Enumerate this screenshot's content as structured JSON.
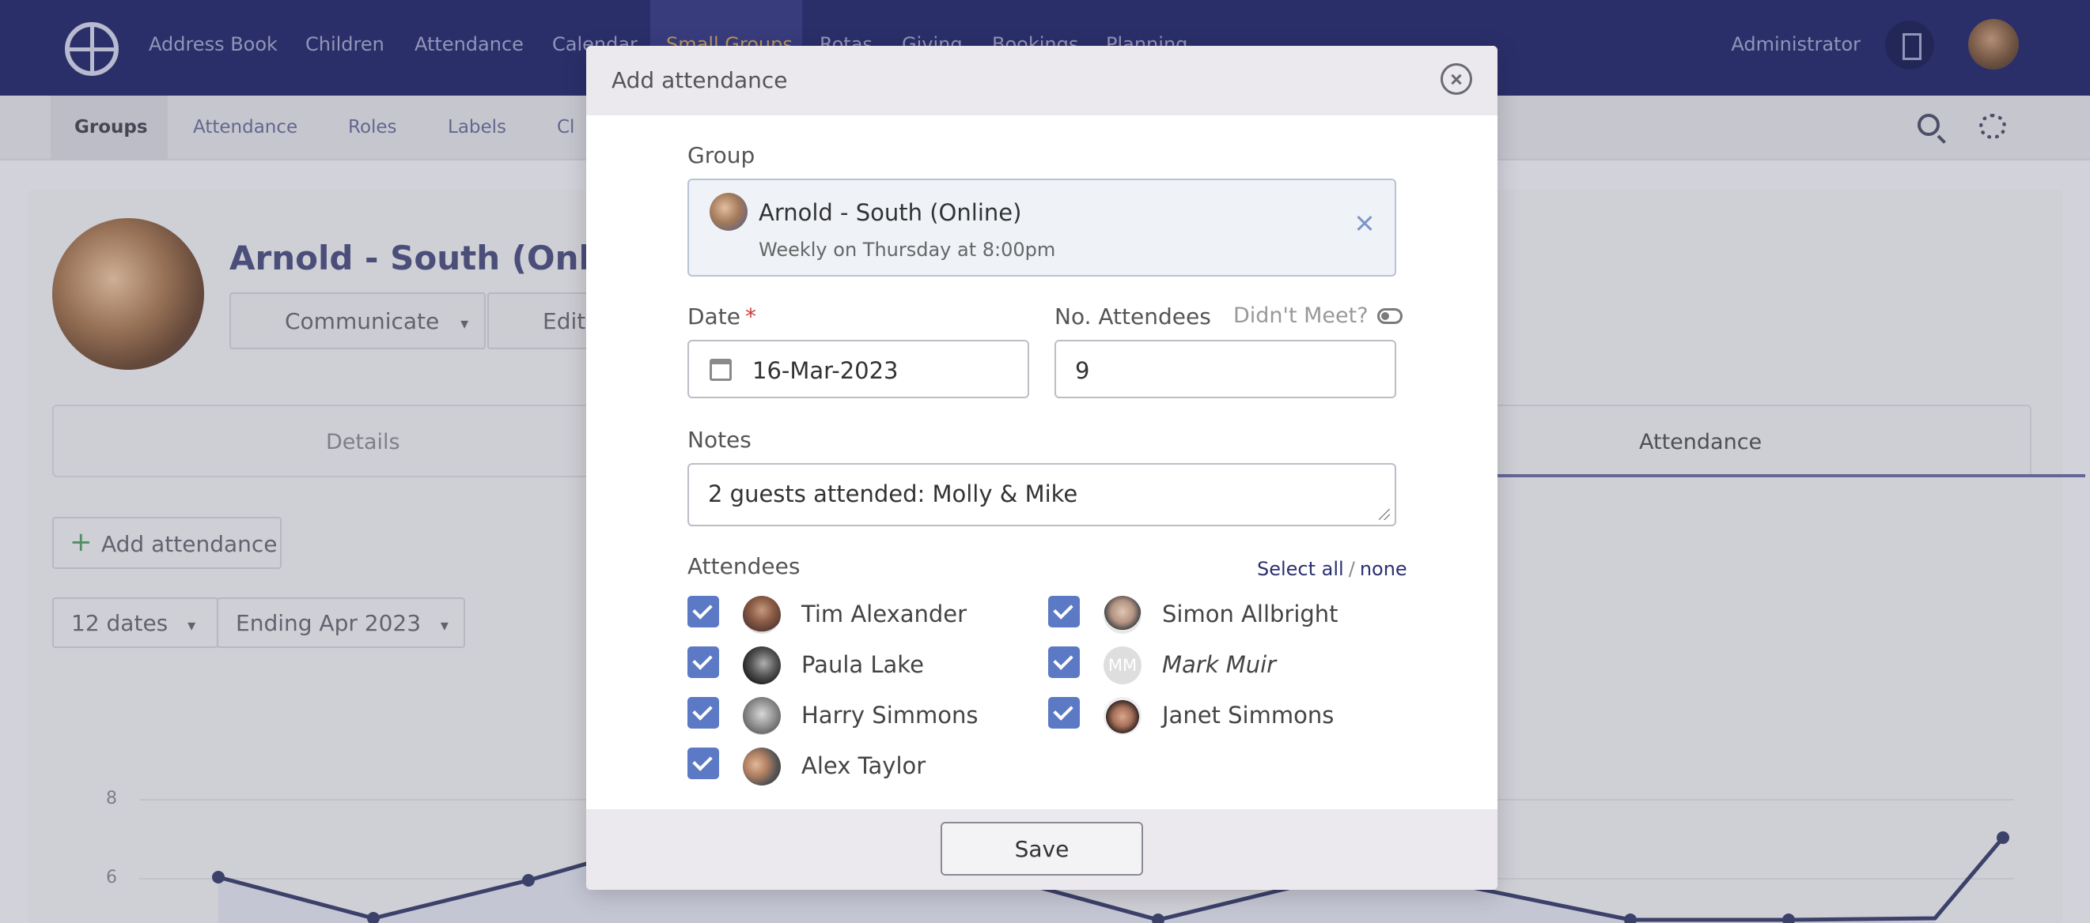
{
  "topnav": {
    "items": [
      "Address Book",
      "Children",
      "Attendance",
      "Calendar",
      "Small Groups",
      "Rotas",
      "Giving",
      "Bookings",
      "Planning"
    ],
    "user": "Administrator"
  },
  "subnav": {
    "items": [
      "Groups",
      "Attendance",
      "Roles",
      "Labels",
      "Cl"
    ]
  },
  "page": {
    "group_title": "Arnold - South (Online)",
    "communicate_label": "Communicate",
    "edit_label": "Edit",
    "tabs": [
      "Details",
      "Attendance"
    ],
    "add_attendance_label": "Add attendance",
    "dates_filter": "12 dates",
    "ending_filter": "Ending Apr 2023",
    "chart_ticks": [
      "8",
      "6"
    ]
  },
  "modal": {
    "title": "Add attendance",
    "group_label": "Group",
    "group_name": "Arnold - South (Online)",
    "group_schedule": "Weekly on Thursday at 8:00pm",
    "date_label": "Date",
    "required_mark": "*",
    "date_value": "16-Mar-2023",
    "attendees_count_label": "No. Attendees",
    "didnt_meet_label": "Didn't Meet?",
    "attendees_count_value": "9",
    "notes_label": "Notes",
    "notes_value": "2 guests attended: Molly & Mike",
    "attendees_label": "Attendees",
    "select_all_label": "Select all",
    "select_sep": "/",
    "select_none_label": "none",
    "attendees": [
      {
        "name": "Tim Alexander",
        "checked": true
      },
      {
        "name": "Simon Allbright",
        "checked": true
      },
      {
        "name": "Paula Lake",
        "checked": true
      },
      {
        "name": "Mark Muir",
        "checked": true,
        "initials": "MM"
      },
      {
        "name": "Harry Simmons",
        "checked": true
      },
      {
        "name": "Janet Simmons",
        "checked": true
      },
      {
        "name": "Alex Taylor",
        "checked": true
      }
    ],
    "save_label": "Save"
  }
}
